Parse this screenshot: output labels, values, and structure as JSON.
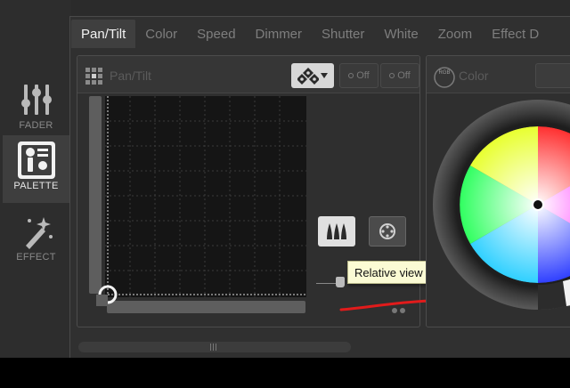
{
  "sidebar": {
    "items": [
      {
        "label": "FADER",
        "icon": "fader-icon",
        "active": false
      },
      {
        "label": "PALETTE",
        "icon": "palette-icon",
        "active": true
      },
      {
        "label": "EFFECT",
        "icon": "effect-wand-icon",
        "active": false
      }
    ]
  },
  "tabs": [
    {
      "label": "Pan/Tilt",
      "active": true
    },
    {
      "label": "Color",
      "active": false
    },
    {
      "label": "Speed",
      "active": false
    },
    {
      "label": "Dimmer",
      "active": false
    },
    {
      "label": "Shutter",
      "active": false
    },
    {
      "label": "White",
      "active": false
    },
    {
      "label": "Zoom",
      "active": false
    },
    {
      "label": "Effect D",
      "active": false
    }
  ],
  "pan_tilt_panel": {
    "title": "Pan/Tilt",
    "off_button_1": "Off",
    "off_button_2": "Off",
    "tooltip": "Relative view"
  },
  "color_panel": {
    "title": "Color",
    "icon_label": "RGB"
  },
  "colors": {
    "active_text": "#f2f2f2",
    "inactive_text": "#7e7e7e",
    "annotation_red": "#e11b1b",
    "tooltip_bg": "#fbfbd4"
  }
}
